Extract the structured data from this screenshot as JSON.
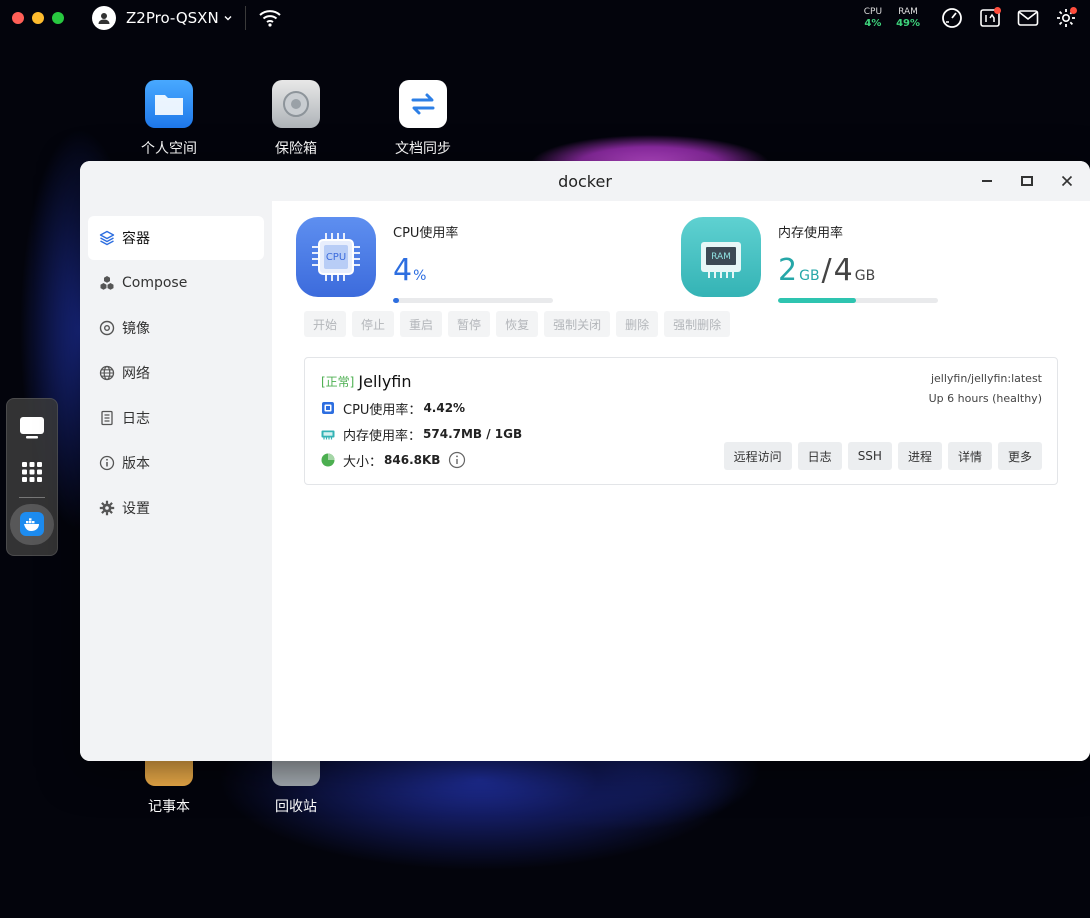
{
  "menubar": {
    "device_name": "Z2Pro-QSXN",
    "cpu_label": "CPU",
    "cpu_value": "4%",
    "ram_label": "RAM",
    "ram_value": "49%"
  },
  "desktop": {
    "icons": [
      {
        "label": "个人空间"
      },
      {
        "label": "保险箱"
      },
      {
        "label": "文档同步"
      },
      {
        "label": "记事本"
      },
      {
        "label": "回收站"
      }
    ]
  },
  "window": {
    "title": "docker",
    "sidebar": [
      {
        "label": "容器",
        "icon": "layers-icon"
      },
      {
        "label": "Compose",
        "icon": "cubes-icon"
      },
      {
        "label": "镜像",
        "icon": "disc-icon"
      },
      {
        "label": "网络",
        "icon": "globe-icon"
      },
      {
        "label": "日志",
        "icon": "document-icon"
      },
      {
        "label": "版本",
        "icon": "info-icon"
      },
      {
        "label": "设置",
        "icon": "gear-icon"
      }
    ],
    "cpu": {
      "label": "CPU使用率",
      "chip_text": "CPU",
      "value": "4",
      "unit": "%",
      "percent": 4
    },
    "ram": {
      "label": "内存使用率",
      "chip_text": "RAM",
      "used": "2",
      "used_unit": "GB",
      "sep": "/",
      "total": "4",
      "total_unit": "GB",
      "percent": 49
    },
    "actions": [
      "开始",
      "停止",
      "重启",
      "暂停",
      "恢复",
      "强制关闭",
      "删除",
      "强制删除"
    ],
    "container": {
      "status": "[正常]",
      "name": "Jellyfin",
      "image": "jellyfin/jellyfin:latest",
      "uptime": "Up 6 hours (healthy)",
      "cpu_label": "CPU使用率：",
      "cpu_value": "4.42%",
      "mem_label": "内存使用率：",
      "mem_value": "574.7MB / 1GB",
      "size_label": "大小：",
      "size_value": "846.8KB",
      "buttons": [
        "远程访问",
        "日志",
        "SSH",
        "进程",
        "详情",
        "更多"
      ]
    }
  },
  "colors": {
    "accent_blue": "#2d6ee0",
    "accent_teal": "#26a7a8",
    "status_green": "#4caf50"
  }
}
